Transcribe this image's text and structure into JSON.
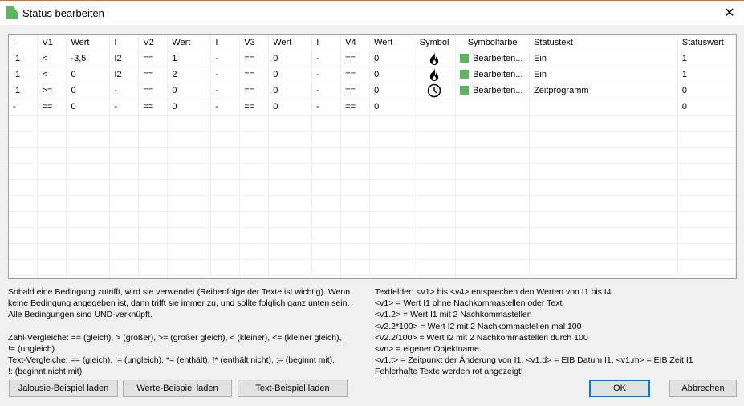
{
  "window": {
    "title": "Status bearbeiten",
    "close_icon": "close-icon"
  },
  "table": {
    "headers": [
      "I",
      "V1",
      "Wert",
      "I",
      "V2",
      "Wert",
      "I",
      "V3",
      "Wert",
      "I",
      "V4",
      "Wert",
      "Symbol",
      "Symbolfarbe",
      "Statustext",
      "Statuswert"
    ],
    "rows": [
      {
        "cells": [
          "I1",
          "<",
          "-3,5",
          "I2",
          "==",
          "1",
          "-",
          "==",
          "0",
          "-",
          "==",
          "0"
        ],
        "symbol": "flame-icon",
        "color": "#5cb85c",
        "color_label": "Bearbeiten...",
        "statustext": "Ein",
        "statuswert": "1"
      },
      {
        "cells": [
          "I1",
          "<",
          "0",
          "I2",
          "==",
          "2",
          "-",
          "==",
          "0",
          "-",
          "==",
          "0"
        ],
        "symbol": "flame-icon",
        "color": "#5cb85c",
        "color_label": "Bearbeiten...",
        "statustext": "Ein",
        "statuswert": "1"
      },
      {
        "cells": [
          "I1",
          ">=",
          "0",
          "-",
          "==",
          "0",
          "-",
          "==",
          "0",
          "-",
          "==",
          "0"
        ],
        "symbol": "clock-icon",
        "color": "#5cb85c",
        "color_label": "Bearbeiten...",
        "statustext": "Zeitprogramm",
        "statuswert": "0"
      },
      {
        "cells": [
          "-",
          "==",
          "0",
          "-",
          "==",
          "0",
          "-",
          "==",
          "0",
          "-",
          "==",
          "0"
        ],
        "symbol": "",
        "color": "",
        "color_label": "",
        "statustext": "",
        "statuswert": "0"
      }
    ]
  },
  "help_left": [
    "Sobald eine Bedingung zutrifft, wird sie verwendet (Reihenfolge der Texte ist wichtig). Wenn",
    "keine Bedingung angegeben ist, dann trifft sie immer zu, und sollte folglich ganz unten sein.",
    "Alle Bedingungen sind UND-verknüpft.",
    "",
    "Zahl-Vergleiche: == (gleich), > (größer), >= (größer gleich), < (kleiner), <= (kleiner gleich),",
    "!= (ungleich)",
    "Text-Vergleiche: == (gleich), != (ungleich), *= (enthält), !* (enthält nicht), := (beginnt mit),",
    "!: (beginnt nicht mit)"
  ],
  "help_right": [
    "Textfelder: <v1> bis <v4> entsprechen den Werten von I1 bis I4",
    "<v1> = Wert I1 ohne Nachkommastellen oder Text",
    "<v1.2> = Wert I1 mit 2 Nachkommastellen",
    "<v2.2*100> = Wert I2 mit 2 Nachkommastellen mal 100",
    "<v2.2/100> = Wert I2 mit 2 Nachkommastellen durch 100",
    "<vn> = eigener Objektname",
    "<v1.t> = Zeitpunkt der Änderung von I1, <v1.d> = EIB Datum I1, <v1.m> = EIB Zeit I1",
    "Fehlerhafte Texte werden rot angezeigt!"
  ],
  "buttons": {
    "jalousie": "Jalousie-Beispiel laden",
    "werte": "Werte-Beispiel laden",
    "text": "Text-Beispiel laden",
    "ok": "OK",
    "cancel": "Abbrechen"
  }
}
